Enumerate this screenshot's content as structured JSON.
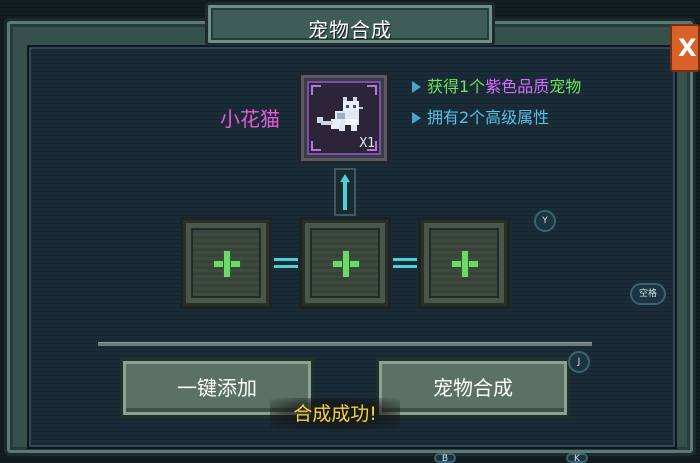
{
  "window": {
    "title": "宠物合成",
    "close_label": "X"
  },
  "result": {
    "pet_name": "小花猫",
    "quantity": "X1",
    "info": [
      {
        "pre": "获得1个",
        "highlight": "紫色品质",
        "post": "宠物"
      },
      {
        "text": "拥有2个高级属性"
      }
    ]
  },
  "buttons": {
    "add_all": "一键添加",
    "merge": "宠物合成"
  },
  "toast": "合成成功!",
  "key_hints": {
    "up_slot": "Y",
    "space": "空格",
    "confirm": "J",
    "bottom_left": "B",
    "bottom_right": "K"
  },
  "colors": {
    "accent": "#4fd0d6",
    "plus": "#6fd86a",
    "rare_name": "#e55ad8",
    "toast": "#f4d23c"
  },
  "icons": {
    "pet": "cat-pixel-icon",
    "add_slot": "plus-icon",
    "arrow": "arrow-up-icon"
  }
}
